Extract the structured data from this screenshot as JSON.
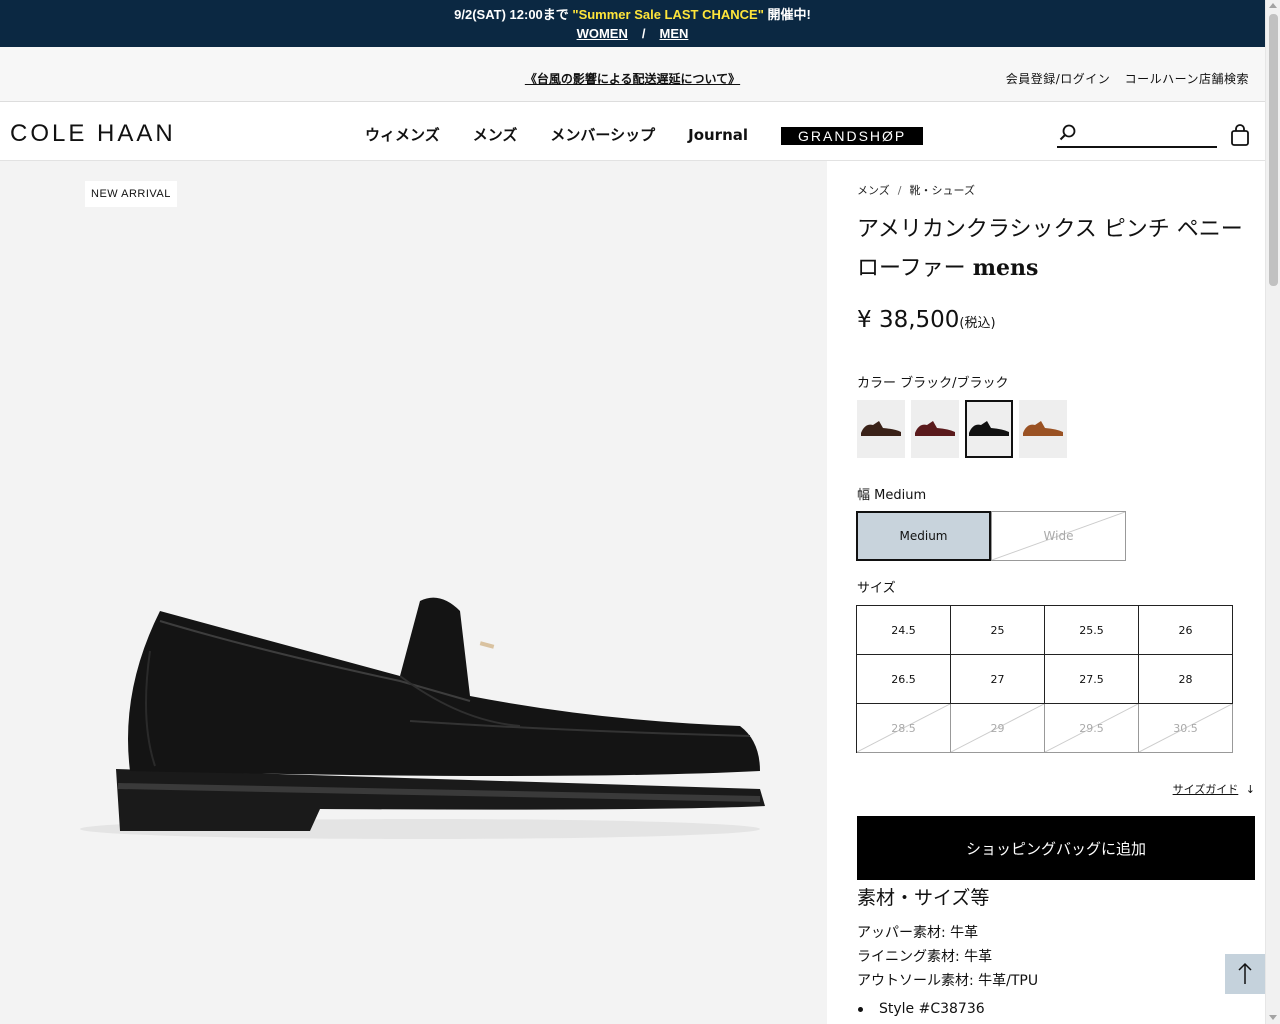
{
  "promo": {
    "pre": "9/2(SAT) 12:00まで ",
    "highlight": "\"Summer Sale LAST CHANCE\"",
    "post": " 開催中!",
    "women": "WOMEN",
    "separator": "/",
    "men": "MEN",
    "highlight_color": "#ffe53a",
    "bg_color": "#0b2842"
  },
  "utility": {
    "notice": "《台風の影響による配送遅延について》",
    "login": "会員登録/ログイン",
    "store_search": "コールハーン店舗検索"
  },
  "header": {
    "logo": "COLE HAAN",
    "nav": [
      "ウィメンズ",
      "メンズ",
      "メンバーシップ",
      "Journal"
    ],
    "grandshop": "GRANDSHØP",
    "search_placeholder": "",
    "search_icon": "search-icon",
    "bag_icon": "shopping-bag-icon"
  },
  "gallery": {
    "badge": "NEW ARRIVAL"
  },
  "product": {
    "breadcrumb": [
      "メンズ",
      "靴・シューズ"
    ],
    "breadcrumb_sep": "/",
    "title_jp": "アメリカンクラシックス ピンチ ペニーローファー",
    "title_en": "mens",
    "price": "¥ 38,500",
    "price_tax": "(税込)",
    "color_label": "カラー ブラック/ブラック",
    "swatches": [
      {
        "name": "dark brown",
        "color": "#3a2218",
        "selected": false
      },
      {
        "name": "burgundy",
        "color": "#5a1a1c",
        "selected": false
      },
      {
        "name": "black",
        "color": "#111111",
        "selected": true
      },
      {
        "name": "tan",
        "color": "#9a5224",
        "selected": false
      }
    ],
    "width_label": "幅 Medium",
    "widths": [
      {
        "label": "Medium",
        "selected": true,
        "available": true
      },
      {
        "label": "Wide",
        "selected": false,
        "available": false
      }
    ],
    "size_label": "サイズ",
    "sizes": [
      {
        "label": "24.5",
        "available": true
      },
      {
        "label": "25",
        "available": true
      },
      {
        "label": "25.5",
        "available": true
      },
      {
        "label": "26",
        "available": true
      },
      {
        "label": "26.5",
        "available": true
      },
      {
        "label": "27",
        "available": true
      },
      {
        "label": "27.5",
        "available": true
      },
      {
        "label": "28",
        "available": true
      },
      {
        "label": "28.5",
        "available": false
      },
      {
        "label": "29",
        "available": false
      },
      {
        "label": "29.5",
        "available": false
      },
      {
        "label": "30.5",
        "available": false
      }
    ],
    "size_guide": "サイズガイド",
    "add_to_bag": "ショッピングバッグに追加",
    "spec_title": "素材・サイズ等",
    "specs": [
      "アッパー素材: 牛革",
      "ライニング素材: 牛革",
      "アウトソール素材: 牛革/TPU"
    ],
    "style": "Style #C38736"
  }
}
